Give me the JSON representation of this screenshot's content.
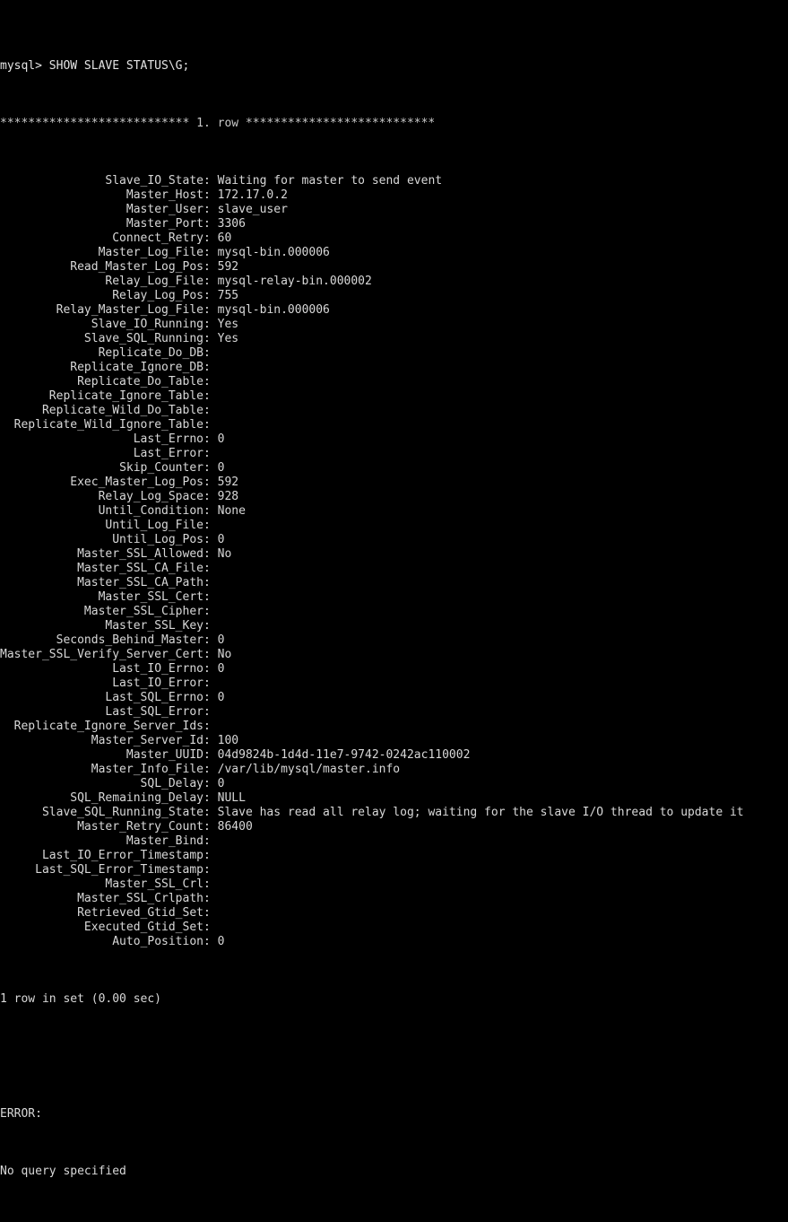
{
  "terminal": {
    "app": "mysql-client-terminal",
    "background_color": "#000000",
    "foreground_color": "#d8d8d8",
    "prompt": "mysql> ",
    "command": "SHOW SLAVE STATUS\\G;",
    "prompt_line": "mysql> SHOW SLAVE STATUS\\G;",
    "row_separator": "*************************** 1. row ***************************",
    "label_column_width": 29,
    "result_footer": "1 row in set (0.00 sec)",
    "error_header": "ERROR:",
    "error_message": "No query specified",
    "fields": [
      {
        "name": "Slave_IO_State",
        "value": "Waiting for master to send event"
      },
      {
        "name": "Master_Host",
        "value": "172.17.0.2"
      },
      {
        "name": "Master_User",
        "value": "slave_user"
      },
      {
        "name": "Master_Port",
        "value": "3306"
      },
      {
        "name": "Connect_Retry",
        "value": "60"
      },
      {
        "name": "Master_Log_File",
        "value": "mysql-bin.000006"
      },
      {
        "name": "Read_Master_Log_Pos",
        "value": "592"
      },
      {
        "name": "Relay_Log_File",
        "value": "mysql-relay-bin.000002"
      },
      {
        "name": "Relay_Log_Pos",
        "value": "755"
      },
      {
        "name": "Relay_Master_Log_File",
        "value": "mysql-bin.000006"
      },
      {
        "name": "Slave_IO_Running",
        "value": "Yes"
      },
      {
        "name": "Slave_SQL_Running",
        "value": "Yes"
      },
      {
        "name": "Replicate_Do_DB",
        "value": ""
      },
      {
        "name": "Replicate_Ignore_DB",
        "value": ""
      },
      {
        "name": "Replicate_Do_Table",
        "value": ""
      },
      {
        "name": "Replicate_Ignore_Table",
        "value": ""
      },
      {
        "name": "Replicate_Wild_Do_Table",
        "value": ""
      },
      {
        "name": "Replicate_Wild_Ignore_Table",
        "value": ""
      },
      {
        "name": "Last_Errno",
        "value": "0"
      },
      {
        "name": "Last_Error",
        "value": ""
      },
      {
        "name": "Skip_Counter",
        "value": "0"
      },
      {
        "name": "Exec_Master_Log_Pos",
        "value": "592"
      },
      {
        "name": "Relay_Log_Space",
        "value": "928"
      },
      {
        "name": "Until_Condition",
        "value": "None"
      },
      {
        "name": "Until_Log_File",
        "value": ""
      },
      {
        "name": "Until_Log_Pos",
        "value": "0"
      },
      {
        "name": "Master_SSL_Allowed",
        "value": "No"
      },
      {
        "name": "Master_SSL_CA_File",
        "value": ""
      },
      {
        "name": "Master_SSL_CA_Path",
        "value": ""
      },
      {
        "name": "Master_SSL_Cert",
        "value": ""
      },
      {
        "name": "Master_SSL_Cipher",
        "value": ""
      },
      {
        "name": "Master_SSL_Key",
        "value": ""
      },
      {
        "name": "Seconds_Behind_Master",
        "value": "0"
      },
      {
        "name": "Master_SSL_Verify_Server_Cert",
        "value": "No"
      },
      {
        "name": "Last_IO_Errno",
        "value": "0"
      },
      {
        "name": "Last_IO_Error",
        "value": ""
      },
      {
        "name": "Last_SQL_Errno",
        "value": "0"
      },
      {
        "name": "Last_SQL_Error",
        "value": ""
      },
      {
        "name": "Replicate_Ignore_Server_Ids",
        "value": ""
      },
      {
        "name": "Master_Server_Id",
        "value": "100"
      },
      {
        "name": "Master_UUID",
        "value": "04d9824b-1d4d-11e7-9742-0242ac110002"
      },
      {
        "name": "Master_Info_File",
        "value": "/var/lib/mysql/master.info"
      },
      {
        "name": "SQL_Delay",
        "value": "0"
      },
      {
        "name": "SQL_Remaining_Delay",
        "value": "NULL"
      },
      {
        "name": "Slave_SQL_Running_State",
        "value": "Slave has read all relay log; waiting for the slave I/O thread to update it"
      },
      {
        "name": "Master_Retry_Count",
        "value": "86400"
      },
      {
        "name": "Master_Bind",
        "value": ""
      },
      {
        "name": "Last_IO_Error_Timestamp",
        "value": ""
      },
      {
        "name": "Last_SQL_Error_Timestamp",
        "value": ""
      },
      {
        "name": "Master_SSL_Crl",
        "value": ""
      },
      {
        "name": "Master_SSL_Crlpath",
        "value": ""
      },
      {
        "name": "Retrieved_Gtid_Set",
        "value": ""
      },
      {
        "name": "Executed_Gtid_Set",
        "value": ""
      },
      {
        "name": "Auto_Position",
        "value": "0"
      }
    ]
  }
}
